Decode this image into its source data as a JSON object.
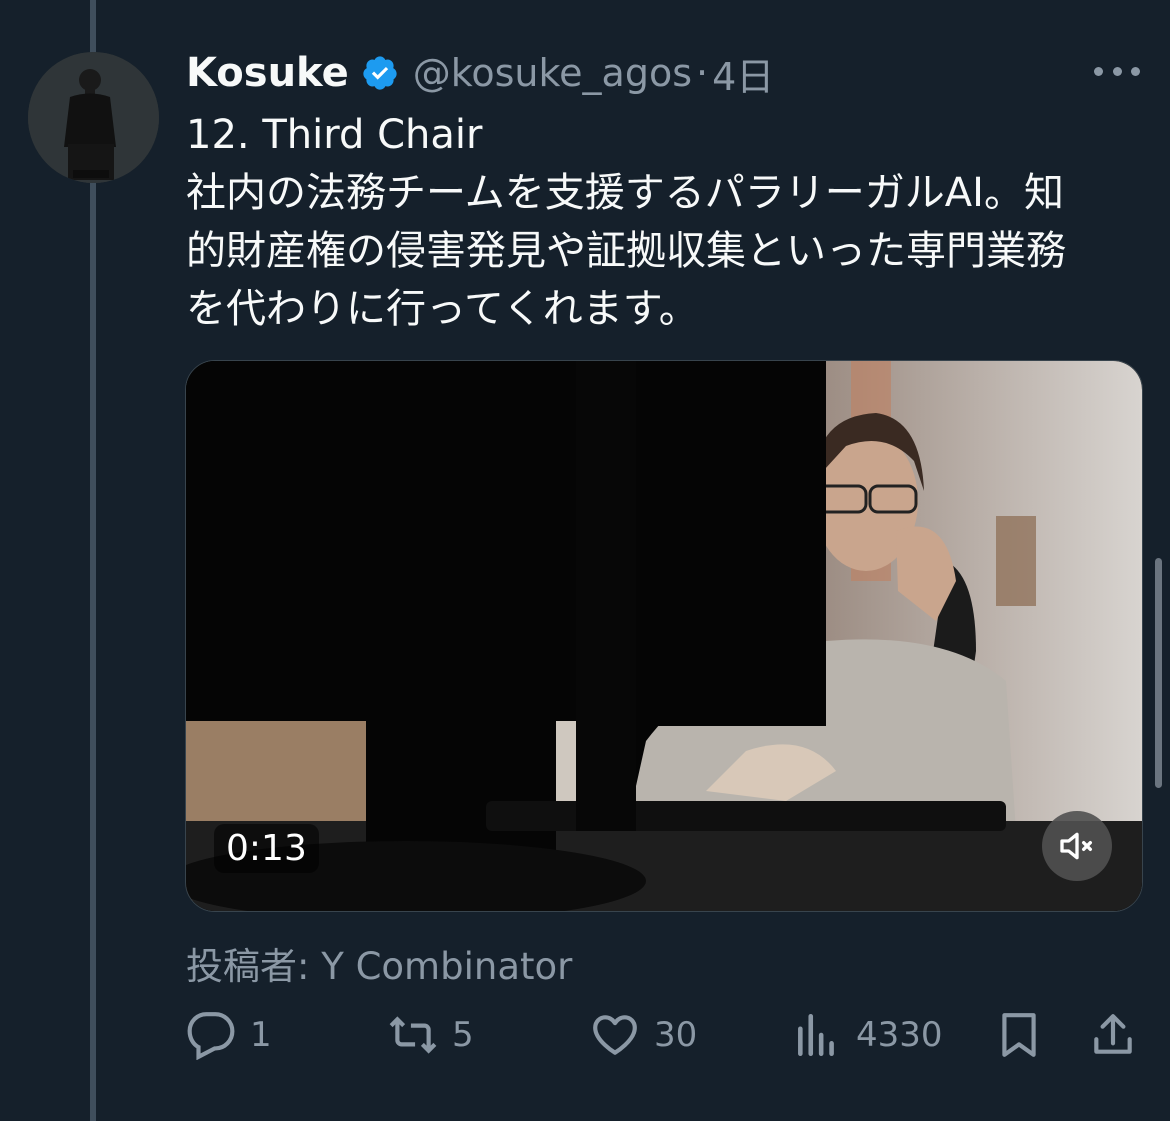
{
  "tweet": {
    "author_name": "Kosuke",
    "handle": "@kosuke_agos",
    "separator": "·",
    "time": "4日",
    "body_lines": [
      "12. Third Chair",
      "社内の法務チームを支援するパラリーガルAI。知",
      "的財産権の侵害発見や証拠収集といった専門業務",
      "を代わりに行ってくれます。"
    ],
    "video": {
      "duration": "0:13",
      "muted": true
    },
    "attribution": "投稿者: Y Combinator",
    "actions": {
      "replies": "1",
      "reposts": "5",
      "likes": "30",
      "views": "4330"
    }
  },
  "colors": {
    "background": "#15202b",
    "verified": "#1d9bf0",
    "secondary_text": "#8b98a5",
    "primary_text": "#f7f9f9"
  }
}
